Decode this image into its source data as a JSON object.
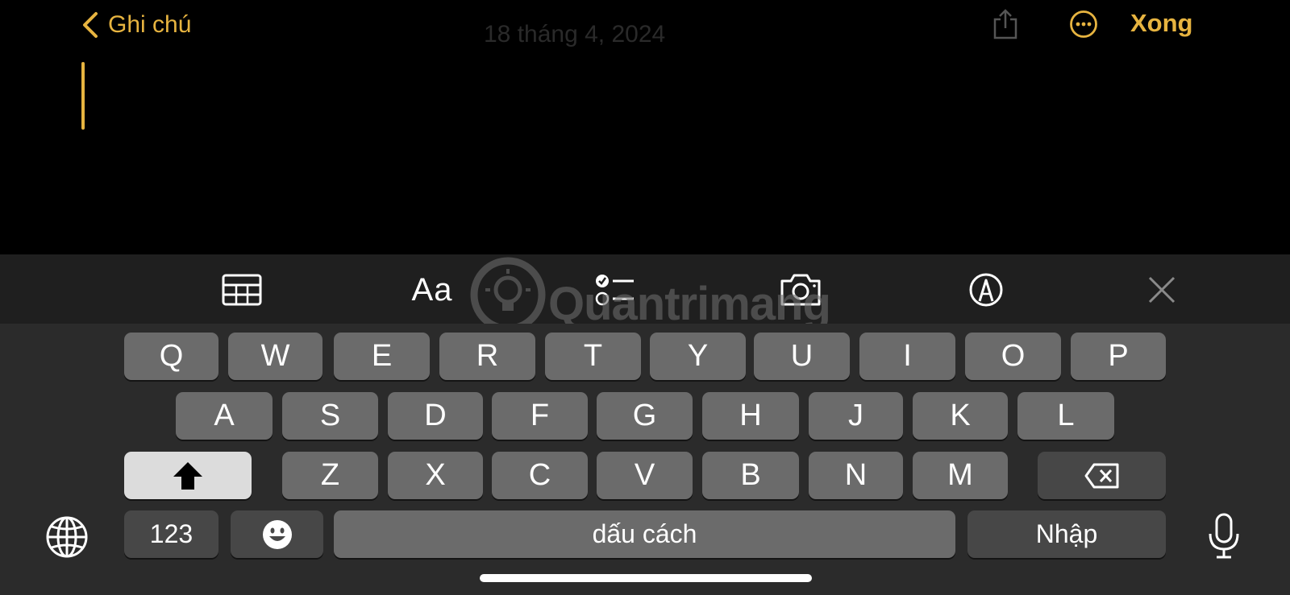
{
  "nav": {
    "back_label": "Ghi chú",
    "note_date": "18 tháng 4, 2024",
    "done_label": "Xong"
  },
  "toolbar": {
    "format_label": "Aa"
  },
  "watermark": {
    "text": "Quantrimang"
  },
  "keyboard": {
    "row1": [
      "Q",
      "W",
      "E",
      "R",
      "T",
      "Y",
      "U",
      "I",
      "O",
      "P"
    ],
    "row2": [
      "A",
      "S",
      "D",
      "F",
      "G",
      "H",
      "J",
      "K",
      "L"
    ],
    "row3": [
      "Z",
      "X",
      "C",
      "V",
      "B",
      "N",
      "M"
    ],
    "numbers_label": "123",
    "space_label": "dấu cách",
    "return_label": "Nhập"
  },
  "colors": {
    "accent": "#E7B440",
    "background": "#000000",
    "keyboard_bg": "#2b2b2b",
    "key": "#6b6b6b",
    "key_dark": "#474747"
  }
}
